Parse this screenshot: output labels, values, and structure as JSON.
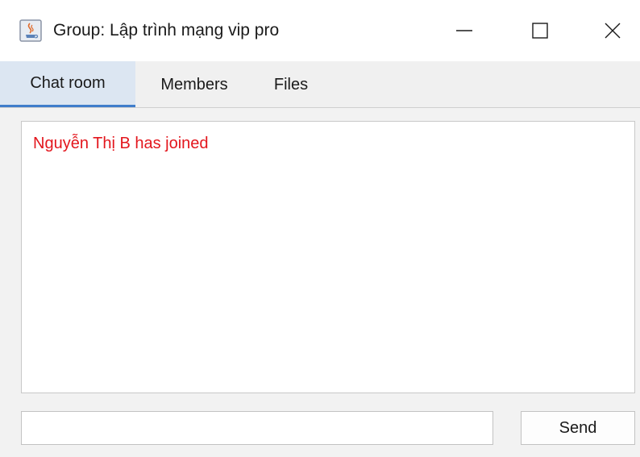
{
  "window": {
    "title": "Group: Lập trình mạng vip pro",
    "app_icon": "java-cup-icon",
    "controls": {
      "minimize": "minimize-icon",
      "maximize": "maximize-icon",
      "close": "close-icon"
    }
  },
  "tabs": [
    {
      "label": "Chat room",
      "active": true
    },
    {
      "label": "Members",
      "active": false
    },
    {
      "label": "Files",
      "active": false
    }
  ],
  "chat": {
    "messages": [
      {
        "text": "Nguyễn Thị B has joined",
        "color": "#e3161d"
      }
    ]
  },
  "composer": {
    "input_value": "",
    "send_label": "Send"
  },
  "colors": {
    "active_tab_bg": "#dce6f2",
    "active_tab_accent": "#3f7dcb",
    "system_message": "#e3161d"
  }
}
